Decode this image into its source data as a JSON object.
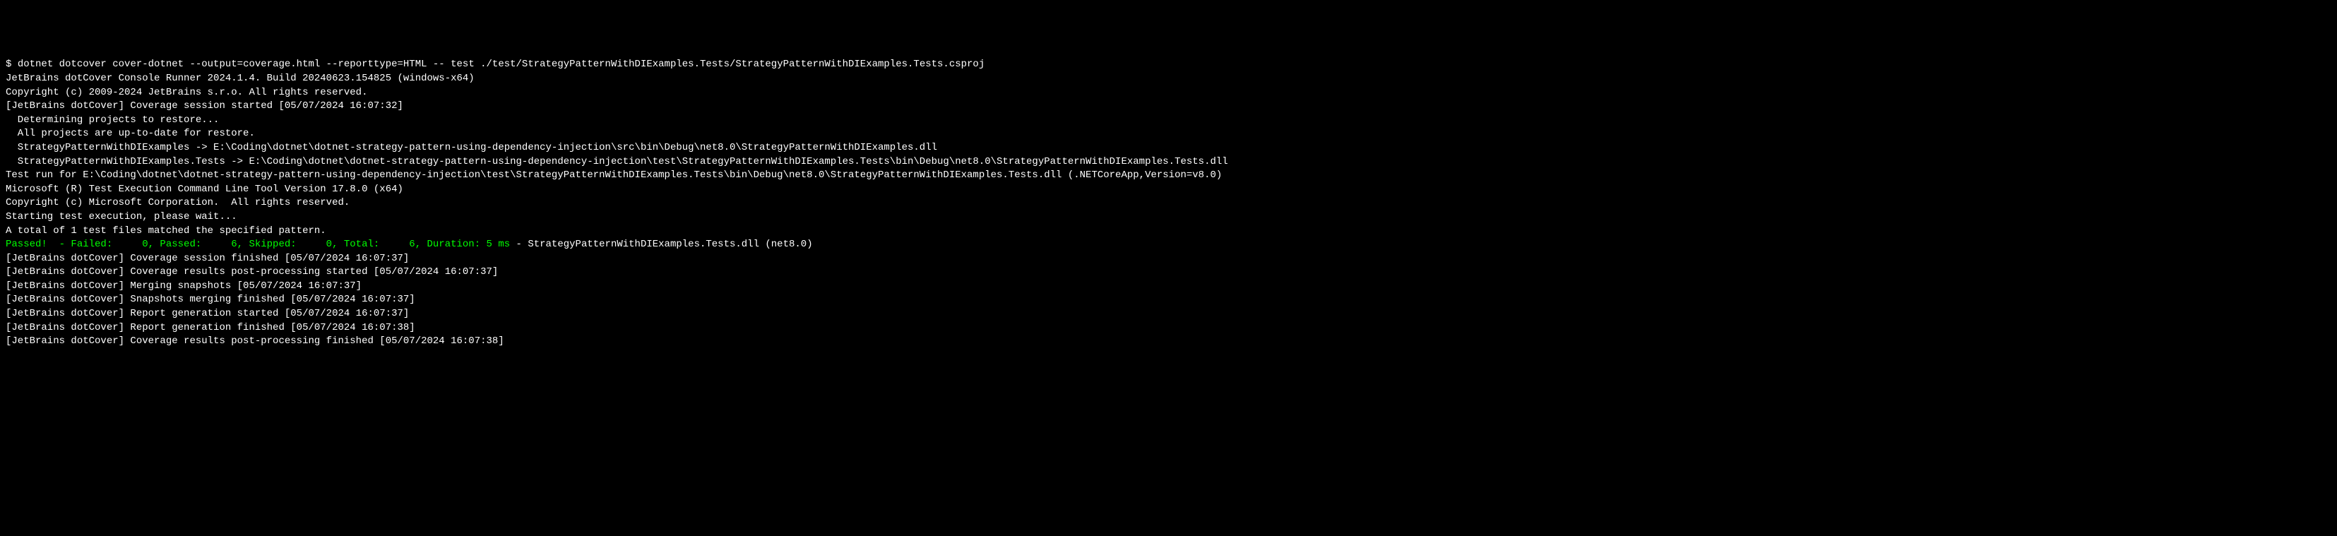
{
  "lines": {
    "prompt": "$ ",
    "command": "dotnet dotcover cover-dotnet --output=coverage.html --reporttype=HTML -- test ./test/StrategyPatternWithDIExamples.Tests/StrategyPatternWithDIExamples.Tests.csproj",
    "l1": "JetBrains dotCover Console Runner 2024.1.4. Build 20240623.154825 (windows-x64)",
    "l2": "Copyright (c) 2009-2024 JetBrains s.r.o. All rights reserved.",
    "l3": "[JetBrains dotCover] Coverage session started [05/07/2024 16:07:32]",
    "l4": "  Determining projects to restore...",
    "l5": "  All projects are up-to-date for restore.",
    "l6": "  StrategyPatternWithDIExamples -> E:\\Coding\\dotnet\\dotnet-strategy-pattern-using-dependency-injection\\src\\bin\\Debug\\net8.0\\StrategyPatternWithDIExamples.dll",
    "l7": "  StrategyPatternWithDIExamples.Tests -> E:\\Coding\\dotnet\\dotnet-strategy-pattern-using-dependency-injection\\test\\StrategyPatternWithDIExamples.Tests\\bin\\Debug\\net8.0\\StrategyPatternWithDIExamples.Tests.dll",
    "l8": "Test run for E:\\Coding\\dotnet\\dotnet-strategy-pattern-using-dependency-injection\\test\\StrategyPatternWithDIExamples.Tests\\bin\\Debug\\net8.0\\StrategyPatternWithDIExamples.Tests.dll (.NETCoreApp,Version=v8.0)",
    "l9": "Microsoft (R) Test Execution Command Line Tool Version 17.8.0 (x64)",
    "l10": "Copyright (c) Microsoft Corporation.  All rights reserved.",
    "l11": "",
    "l12": "Starting test execution, please wait...",
    "l13": "A total of 1 test files matched the specified pattern.",
    "l14": "",
    "summary_green": "Passed!  - Failed:     0, Passed:     6, Skipped:     0, Total:     6, Duration: 5 ms",
    "summary_white": " - StrategyPatternWithDIExamples.Tests.dll (net8.0)",
    "l16": "[JetBrains dotCover] Coverage session finished [05/07/2024 16:07:37]",
    "l17": "[JetBrains dotCover] Coverage results post-processing started [05/07/2024 16:07:37]",
    "l18": "[JetBrains dotCover] Merging snapshots [05/07/2024 16:07:37]",
    "l19": "[JetBrains dotCover] Snapshots merging finished [05/07/2024 16:07:37]",
    "l20": "[JetBrains dotCover] Report generation started [05/07/2024 16:07:37]",
    "l21": "[JetBrains dotCover] Report generation finished [05/07/2024 16:07:38]",
    "l22": "[JetBrains dotCover] Coverage results post-processing finished [05/07/2024 16:07:38]"
  }
}
